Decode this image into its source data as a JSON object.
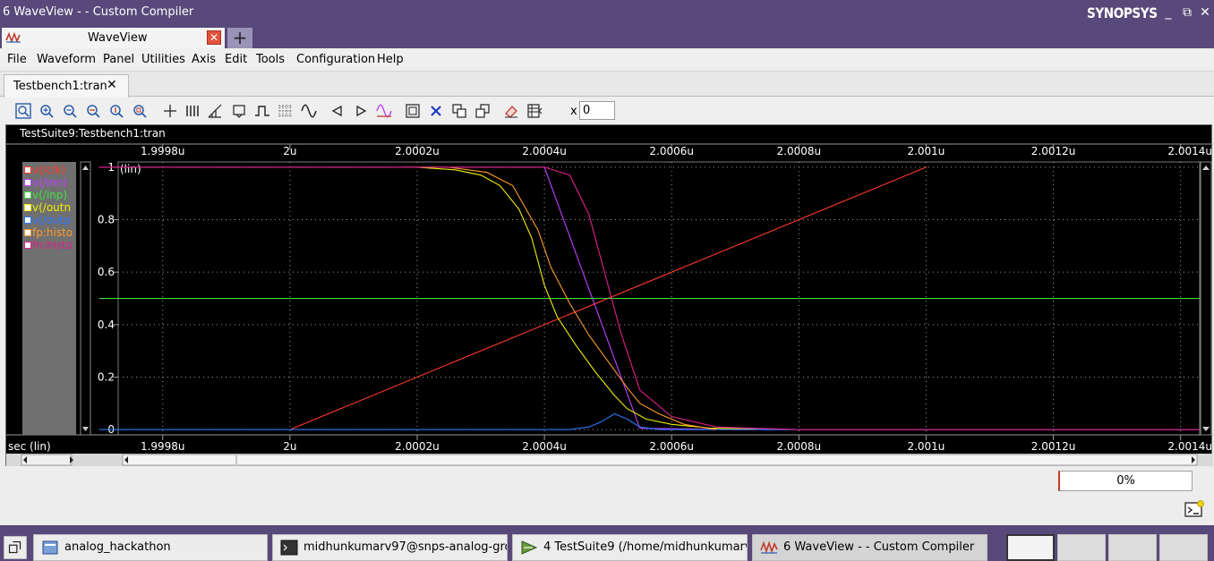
{
  "window": {
    "title": "6 WaveView -  - Custom Compiler",
    "brand": "SYNOPSYS",
    "minimize": "_",
    "restore": "⧉",
    "close": "✕"
  },
  "app_tab": {
    "label": "WaveView",
    "close": "✕",
    "add": "+"
  },
  "menu": [
    "File",
    "Waveform",
    "Panel",
    "Utilities",
    "Axis",
    "Edit",
    "Tools",
    "Configuration",
    "Help"
  ],
  "doc_tab": {
    "label": "Testbench1:tran",
    "close": "✕"
  },
  "toolbar": {
    "buttons": [
      "zoom-fit",
      "zoom-in",
      "zoom-out",
      "zoom-x",
      "zoom-y",
      "zoom-box",
      "cursor",
      "bus",
      "measure",
      "marker",
      "pulse",
      "grid",
      "sine",
      "prev",
      "next",
      "wave-compare",
      "fit-panel",
      "delete",
      "copy",
      "paste",
      "eraser",
      "table"
    ],
    "x_label": "x",
    "x_value": "0"
  },
  "panel": {
    "header": "TestSuite9:Testbench1:tran",
    "x_ticks": [
      "1.9998u",
      "2u",
      "2.0002u",
      "2.0004u",
      "2.0006u",
      "2.0008u",
      "2.001u",
      "2.0012u",
      "2.0014u"
    ],
    "x_axis_label": "sec (lin)",
    "y_ticks": [
      "1",
      "0.8",
      "0.6",
      "0.4",
      "0.2",
      "0"
    ],
    "y_scale_label": "(lin)",
    "background": "#000000",
    "grid_color": "#9a9a9a",
    "legend": [
      {
        "label": "v(/clk)",
        "color": "#ff3a2a"
      },
      {
        "label": "v(/inn)",
        "color": "#c040ff"
      },
      {
        "label": "v(/inp)",
        "color": "#40e040"
      },
      {
        "label": "v(/outn",
        "color": "#f0f000"
      },
      {
        "label": "v(/outp",
        "color": "#2a78ff"
      },
      {
        "label": "fp:histo",
        "color": "#ff9a2a"
      },
      {
        "label": "fn:histo",
        "color": "#e0208a"
      }
    ]
  },
  "chart_data": {
    "type": "line",
    "xlabel": "sec (lin)",
    "ylabel": "(lin)",
    "xlim": [
      "1.99973u",
      "2.00143u"
    ],
    "ylim": [
      -0.02,
      1.02
    ],
    "grid": true,
    "series": [
      {
        "name": "v(/clk)",
        "color": "#ff3a2a",
        "x": [
          "2.0000u",
          "2.0010u"
        ],
        "y": [
          0,
          1
        ]
      },
      {
        "name": "v(/inn)",
        "color": "#c040ff",
        "x": [
          "1.99970u",
          "2.00020u",
          "2.00035u",
          "2.00040u",
          "2.00055u",
          "2.00070u",
          "2.00143u"
        ],
        "y": [
          1,
          1,
          1,
          1,
          0.005,
          0,
          0
        ]
      },
      {
        "name": "v(/inp)",
        "color": "#40e040",
        "x": [
          "1.99970u",
          "2.00143u"
        ],
        "y": [
          0.5,
          0.5
        ]
      },
      {
        "name": "v(/outn",
        "color": "#f0f000",
        "x": [
          "2.00020u",
          "2.00026u",
          "2.00030u",
          "2.00033u",
          "2.00036u",
          "2.00038u",
          "2.00040u",
          "2.00042u",
          "2.00045u",
          "2.00048u",
          "2.00051u",
          "2.00053u",
          "2.00056u",
          "2.00060u",
          "2.00066u",
          "2.00075u"
        ],
        "y": [
          1,
          0.99,
          0.97,
          0.93,
          0.84,
          0.73,
          0.55,
          0.43,
          0.32,
          0.22,
          0.13,
          0.08,
          0.04,
          0.02,
          0.006,
          0
        ]
      },
      {
        "name": "v(/outp",
        "color": "#2a78ff",
        "x": [
          "1.99970u",
          "2.00044u",
          "2.00047u",
          "2.00049u",
          "2.00051u",
          "2.00053u",
          "2.00055u",
          "2.00058u",
          "2.00143u"
        ],
        "y": [
          0,
          0,
          0.01,
          0.03,
          0.06,
          0.04,
          0.01,
          0,
          0
        ]
      },
      {
        "name": "fp:histo",
        "color": "#ff9a2a",
        "x": [
          "2.00018u",
          "2.00025u",
          "2.00031u",
          "2.00035u",
          "2.00039u",
          "2.00041u",
          "2.00044u",
          "2.00047u",
          "2.00050u",
          "2.00053u",
          "2.00055u",
          "2.00058u",
          "2.00062u",
          "2.00067u"
        ],
        "y": [
          1,
          1,
          0.98,
          0.93,
          0.76,
          0.62,
          0.48,
          0.36,
          0.26,
          0.16,
          0.1,
          0.06,
          0.02,
          0
        ]
      },
      {
        "name": "fn:histo",
        "color": "#e0208a",
        "x": [
          "1.99970u",
          "2.00040u",
          "2.00044u",
          "2.00047u",
          "2.00050u",
          "2.00052u",
          "2.00055u",
          "2.00060u",
          "2.00067u",
          "2.00080u",
          "2.00143u"
        ],
        "y": [
          1,
          1,
          0.97,
          0.82,
          0.55,
          0.37,
          0.15,
          0.05,
          0.01,
          0,
          0
        ]
      }
    ]
  },
  "status": {
    "progress": "0%"
  },
  "taskbar": {
    "items": [
      {
        "label": "analog_hackathon",
        "icon": "folder-icon"
      },
      {
        "label": "midhunkumarv97@snps-analog-gro...",
        "icon": "terminal-icon"
      },
      {
        "label": "4 TestSuite9 (/home/midhunkumarv...",
        "icon": "flow-icon"
      },
      {
        "label": "6 WaveView -  - Custom Compiler",
        "icon": "waveview-icon"
      }
    ]
  }
}
